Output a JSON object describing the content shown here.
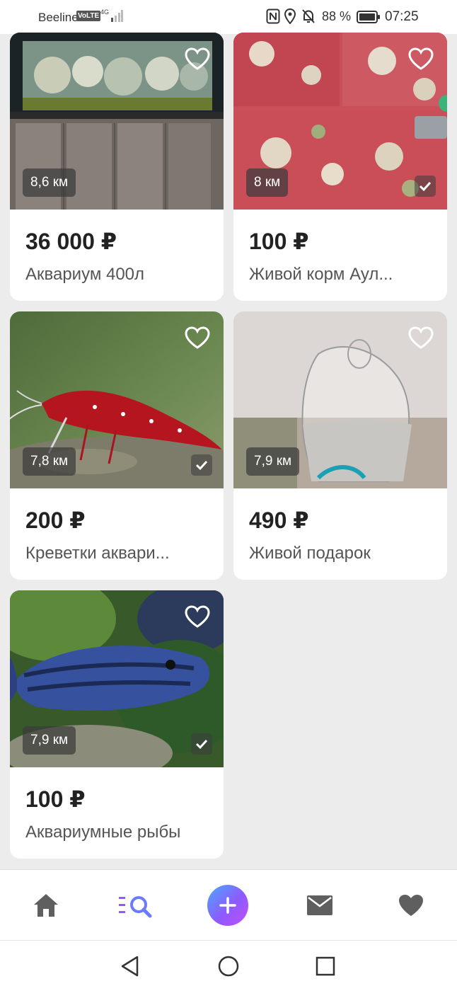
{
  "status_bar": {
    "carrier": "Beeline",
    "volte": "VoLTE",
    "network": "4G",
    "battery": "88 %",
    "time": "07:25"
  },
  "listings": [
    {
      "distance": "8,6 км",
      "price": "36 000 ₽",
      "title": "Аквариум 400л",
      "verified": false
    },
    {
      "distance": "8 км",
      "price": "100 ₽",
      "title": "Живой корм Аул...",
      "verified": true
    },
    {
      "distance": "7,8 км",
      "price": "200 ₽",
      "title": "Креветки аквари...",
      "verified": true
    },
    {
      "distance": "7,9 км",
      "price": "490 ₽",
      "title": "Живой подарок",
      "verified": false
    },
    {
      "distance": "7,9 км",
      "price": "100 ₽",
      "title": "Аквариумные рыбы",
      "verified": true
    }
  ],
  "bottom_nav": {
    "items": [
      {
        "icon": "home-icon"
      },
      {
        "icon": "search-list-icon"
      },
      {
        "icon": "plus-icon"
      },
      {
        "icon": "mail-icon"
      },
      {
        "icon": "heart-icon"
      }
    ],
    "accent": "#8d5bff"
  },
  "system_nav": {
    "icons": [
      "back-icon",
      "home-circle-icon",
      "recents-icon"
    ]
  }
}
